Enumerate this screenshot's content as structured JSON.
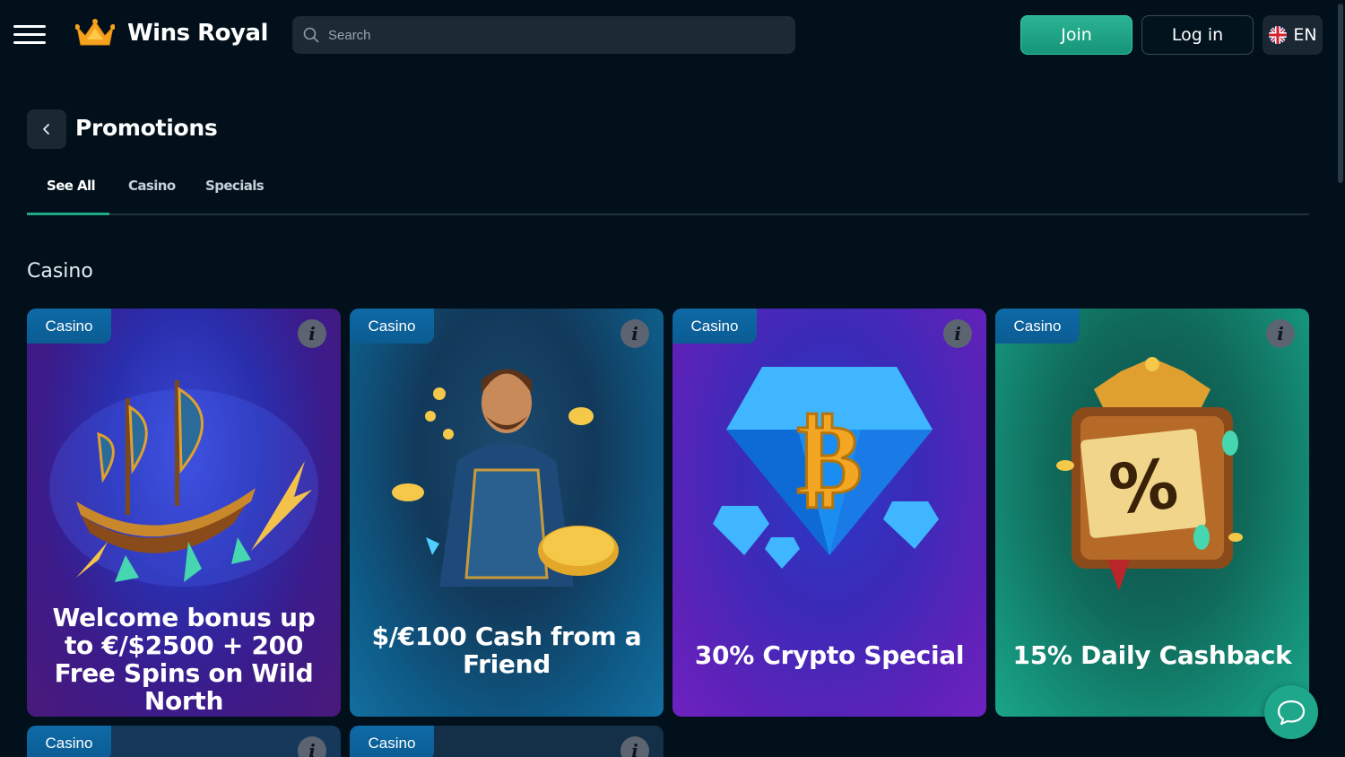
{
  "header": {
    "logo_text": "Wins Royal",
    "search_placeholder": "Search",
    "join_label": "Join",
    "login_label": "Log in",
    "lang_label": "EN"
  },
  "page": {
    "title": "Promotions",
    "tabs": [
      {
        "label": "See All",
        "active": true
      },
      {
        "label": "Casino",
        "active": false
      },
      {
        "label": "Specials",
        "active": false
      }
    ],
    "section_title": "Casino"
  },
  "cards": [
    {
      "badge": "Casino",
      "title": "Welcome bonus up to €/$2500 + 200 Free Spins on Wild North",
      "theme": "#6a2bd6"
    },
    {
      "badge": "Casino",
      "title": "$/€100 Cash from a Friend",
      "theme": "#126c9a"
    },
    {
      "badge": "Casino",
      "title": "30% Crypto Special",
      "theme": "#7c2bd8"
    },
    {
      "badge": "Casino",
      "title": "15% Daily Cashback",
      "theme": "#14a07e"
    },
    {
      "badge": "Casino",
      "title": ""
    },
    {
      "badge": "Casino",
      "title": ""
    }
  ],
  "icons": {
    "menu": "hamburger-icon",
    "search": "search-icon",
    "flag": "uk-flag-icon",
    "back": "chevron-left-icon",
    "info": "info-icon",
    "chat": "chat-bubble-icon"
  },
  "colors": {
    "background": "#01101a",
    "accent": "#1fa985",
    "badge": "#0e6aa6"
  }
}
